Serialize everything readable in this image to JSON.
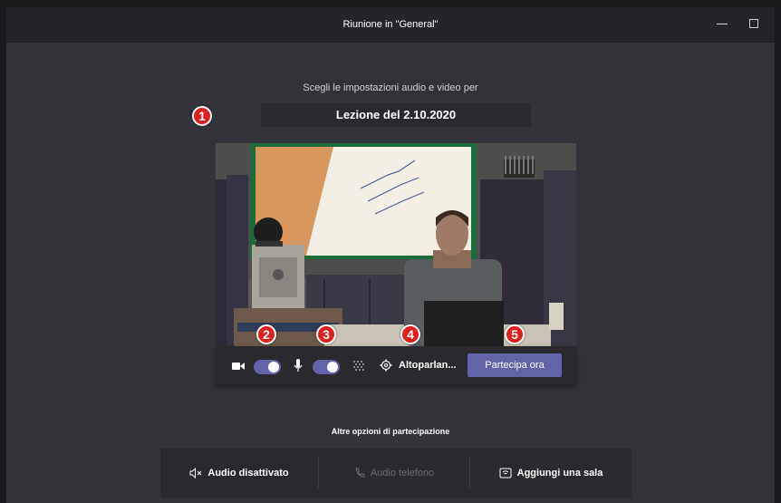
{
  "window": {
    "title": "Riunione in \"General\""
  },
  "prejoin": {
    "prompt": "Scegli le impostazioni audio e video per",
    "meeting_title": "Lezione del 2.10.2020"
  },
  "badges": [
    "1",
    "2",
    "3",
    "4",
    "5"
  ],
  "controls": {
    "camera_on": true,
    "mic_on": true,
    "speaker_label": "Altoparlan...",
    "join_label": "Partecipa ora"
  },
  "other_options": {
    "heading": "Altre opzioni di partecipazione",
    "audio_off": "Audio disattivato",
    "phone_audio": "Audio telefono",
    "add_room": "Aggiungi una sala"
  },
  "colors": {
    "accent": "#6264a7",
    "badge": "#e01e1e",
    "background": "#333238"
  }
}
